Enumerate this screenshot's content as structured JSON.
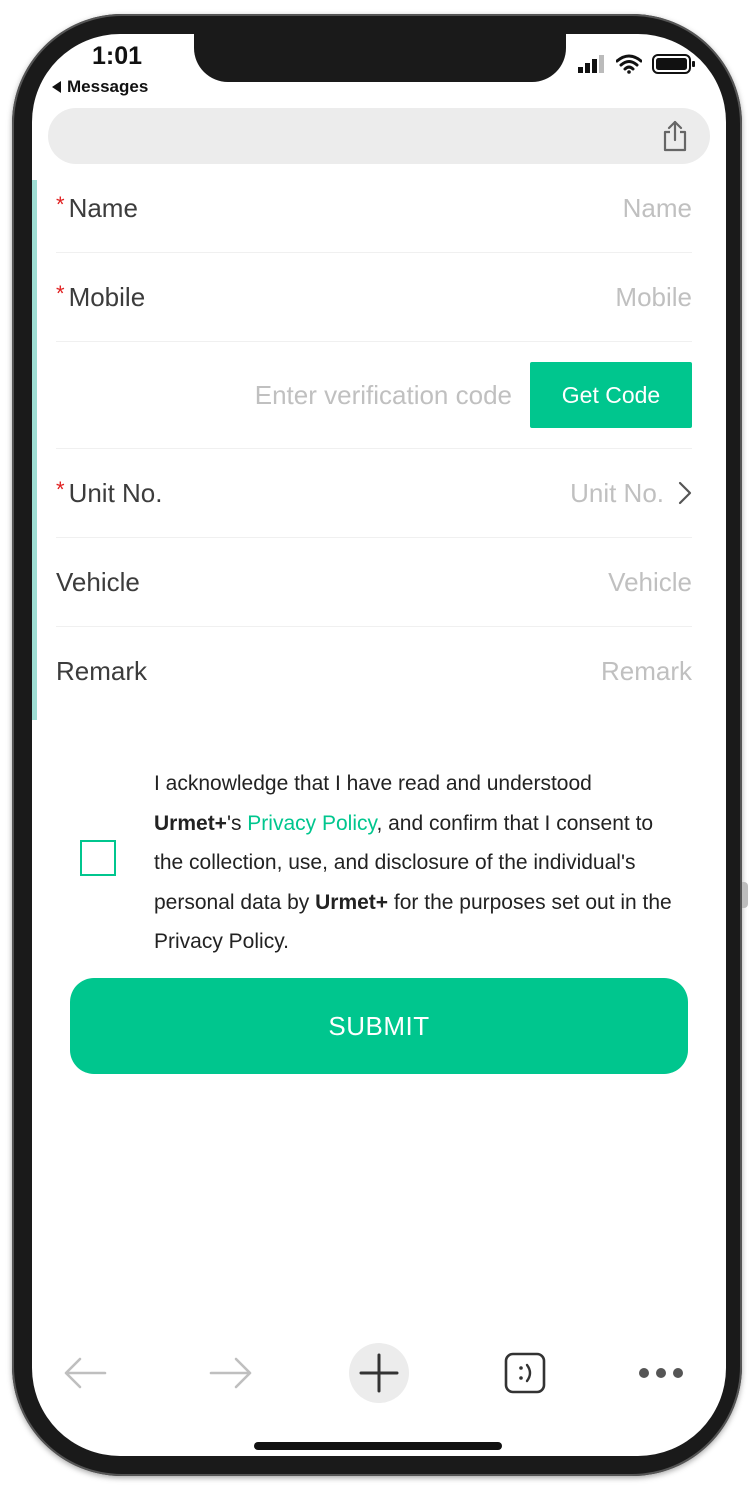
{
  "status_bar": {
    "time": "1:01",
    "back_label": "Messages"
  },
  "form": {
    "name": {
      "label": "Name",
      "placeholder": "Name",
      "required": true
    },
    "mobile": {
      "label": "Mobile",
      "placeholder": "Mobile",
      "required": true
    },
    "verification": {
      "placeholder": "Enter verification code",
      "button_label": "Get Code"
    },
    "unit": {
      "label": "Unit No.",
      "placeholder": "Unit No.",
      "required": true
    },
    "vehicle": {
      "label": "Vehicle",
      "placeholder": "Vehicle",
      "required": false
    },
    "remark": {
      "label": "Remark",
      "placeholder": "Remark",
      "required": false
    },
    "required_marker": "*"
  },
  "consent": {
    "line_1": "I acknowledge that I have read and understood",
    "brand": "Urmet+",
    "possessive": "'s ",
    "privacy_link": "Privacy Policy",
    "after_link": ", and confirm that I consent to the collection, use, and disclosure of the individual's personal data by ",
    "brand_2": "Urmet+",
    "ending": " for the purposes set out in the Privacy Policy."
  },
  "submit_label": "SUBMIT",
  "colors": {
    "accent": "#00c68e",
    "required": "#e02020",
    "placeholder": "#c0c0c0",
    "label": "#3c3c3c"
  },
  "icons": {
    "share": "share-icon",
    "back": "arrow-left-icon",
    "forward": "arrow-right-icon",
    "new_tab": "plus-icon",
    "tabs": "tabs-smiley-icon",
    "more": "more-dots-icon"
  }
}
